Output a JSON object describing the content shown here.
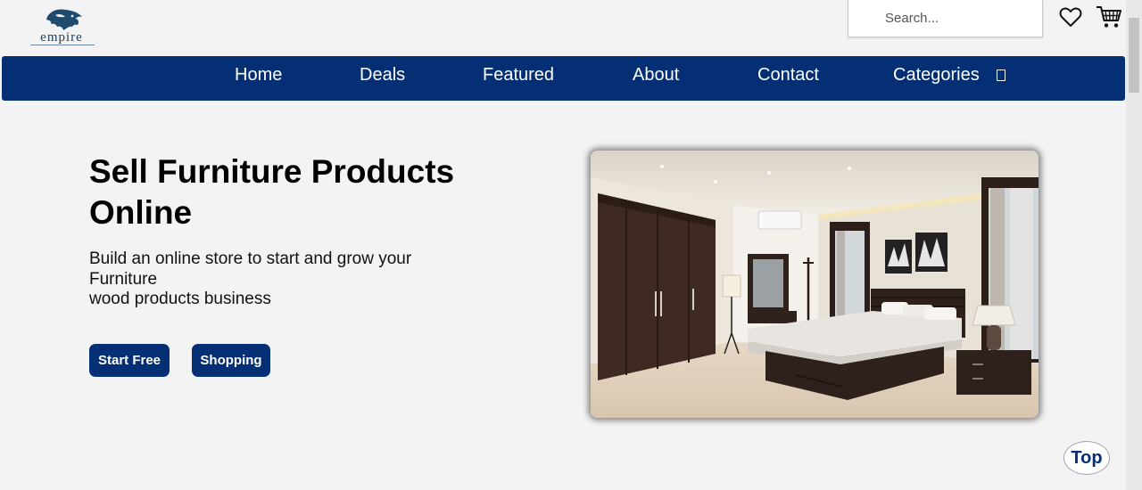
{
  "brand": {
    "name": "empire",
    "logo_icon": "lion-icon"
  },
  "header": {
    "search": {
      "placeholder": "Search...",
      "value": ""
    },
    "icons": [
      "heart-icon",
      "cart-icon"
    ]
  },
  "nav": {
    "items": [
      {
        "label": "Home"
      },
      {
        "label": "Deals"
      },
      {
        "label": "Featured"
      },
      {
        "label": "About"
      },
      {
        "label": "Contact"
      },
      {
        "label": "Categories"
      }
    ],
    "categories_icon": "dropdown-icon"
  },
  "hero": {
    "title": "Sell Furniture Products Online",
    "subtitle_lines": [
      "Build an online store to start and grow your",
      "Furniture",
      "wood products business"
    ],
    "buttons": {
      "start": "Start Free",
      "shop": "Shopping"
    },
    "image_subject": "bedroom-furniture-photo"
  },
  "back_to_top": {
    "label": "Top"
  },
  "colors": {
    "primary": "#042f74",
    "background": "#f3f3f3",
    "text": "#000000"
  }
}
